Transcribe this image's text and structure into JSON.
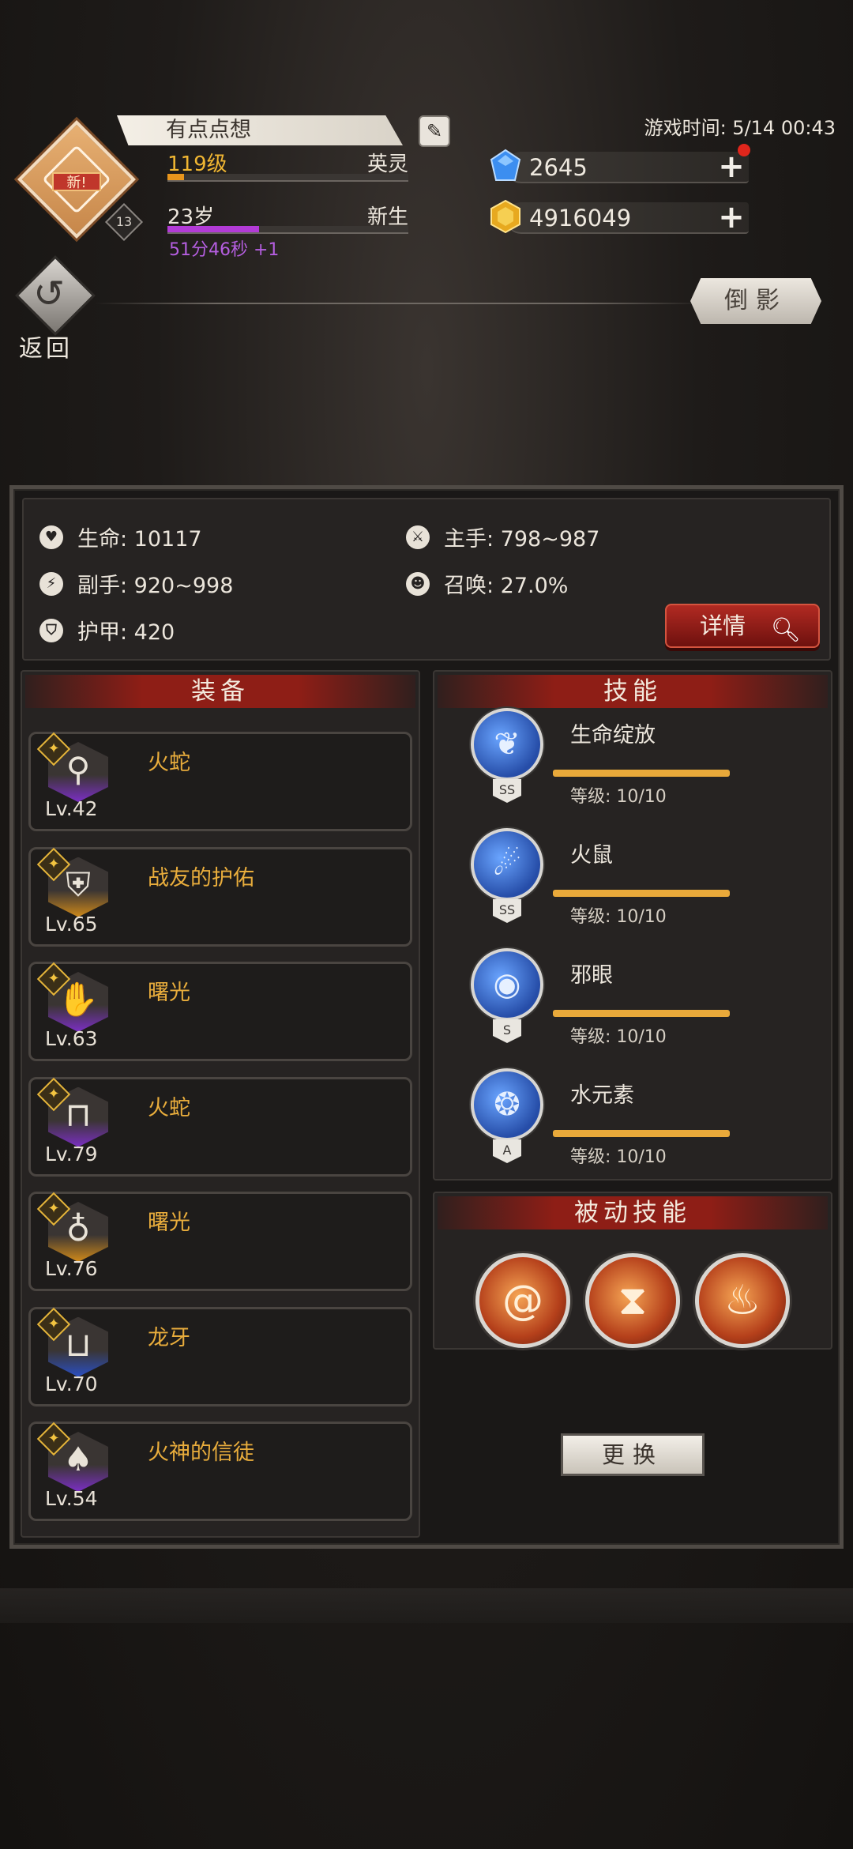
{
  "player": {
    "name": "有点点想",
    "avatar_badge": "新!",
    "avatar_count": "13",
    "level": "119级",
    "class": "英灵",
    "level_progress": 0.07,
    "age": "23岁",
    "stage": "新生",
    "age_progress": 0.38,
    "age_timer": "51分46秒 +1"
  },
  "game_time": "游戏时间: 5/14 00:43",
  "currency": {
    "gems": "2645",
    "gold": "4916049"
  },
  "nav": {
    "back_label": "返回",
    "reflection_label": "倒影"
  },
  "stats": {
    "life": "生命: 10117",
    "main_hand": "主手: 798~987",
    "off_hand": "副手: 920~998",
    "summon": "召唤: 27.0%",
    "armor": "护甲: 420",
    "detail_label": "详情"
  },
  "equipment": {
    "header": "装备",
    "items": [
      {
        "name": "火蛇",
        "level": "Lv.42",
        "icon": "pendant-icon",
        "rarity_color": "#7b2fc4"
      },
      {
        "name": "战友的护佑",
        "level": "Lv.65",
        "icon": "armor-icon",
        "rarity_color": "#d08a1a"
      },
      {
        "name": "曙光",
        "level": "Lv.63",
        "icon": "gauntlet-icon",
        "rarity_color": "#7b2fc4"
      },
      {
        "name": "火蛇",
        "level": "Lv.79",
        "icon": "boots-icon",
        "rarity_color": "#7b2fc4"
      },
      {
        "name": "曙光",
        "level": "Lv.76",
        "icon": "amulet-icon",
        "rarity_color": "#d08a1a"
      },
      {
        "name": "龙牙",
        "level": "Lv.70",
        "icon": "belt-icon",
        "rarity_color": "#2a4fc4"
      },
      {
        "name": "火神的信徒",
        "level": "Lv.54",
        "icon": "cloak-icon",
        "rarity_color": "#7b2fc4"
      }
    ]
  },
  "skills": {
    "header": "技能",
    "items": [
      {
        "name": "生命绽放",
        "rank": "SS",
        "level": "等级: 10/10",
        "icon": "bloom-icon"
      },
      {
        "name": "火鼠",
        "rank": "SS",
        "level": "等级: 10/10",
        "icon": "fire-rat-icon"
      },
      {
        "name": "邪眼",
        "rank": "S",
        "level": "等级: 10/10",
        "icon": "evil-eye-icon"
      },
      {
        "name": "水元素",
        "rank": "A",
        "level": "等级: 10/10",
        "icon": "water-elemental-icon"
      }
    ]
  },
  "passive": {
    "header": "被动技能",
    "items": [
      {
        "icon": "spiral-icon"
      },
      {
        "icon": "hourglass-icon"
      },
      {
        "icon": "flame-figure-icon"
      }
    ]
  },
  "swap_label": "更换"
}
